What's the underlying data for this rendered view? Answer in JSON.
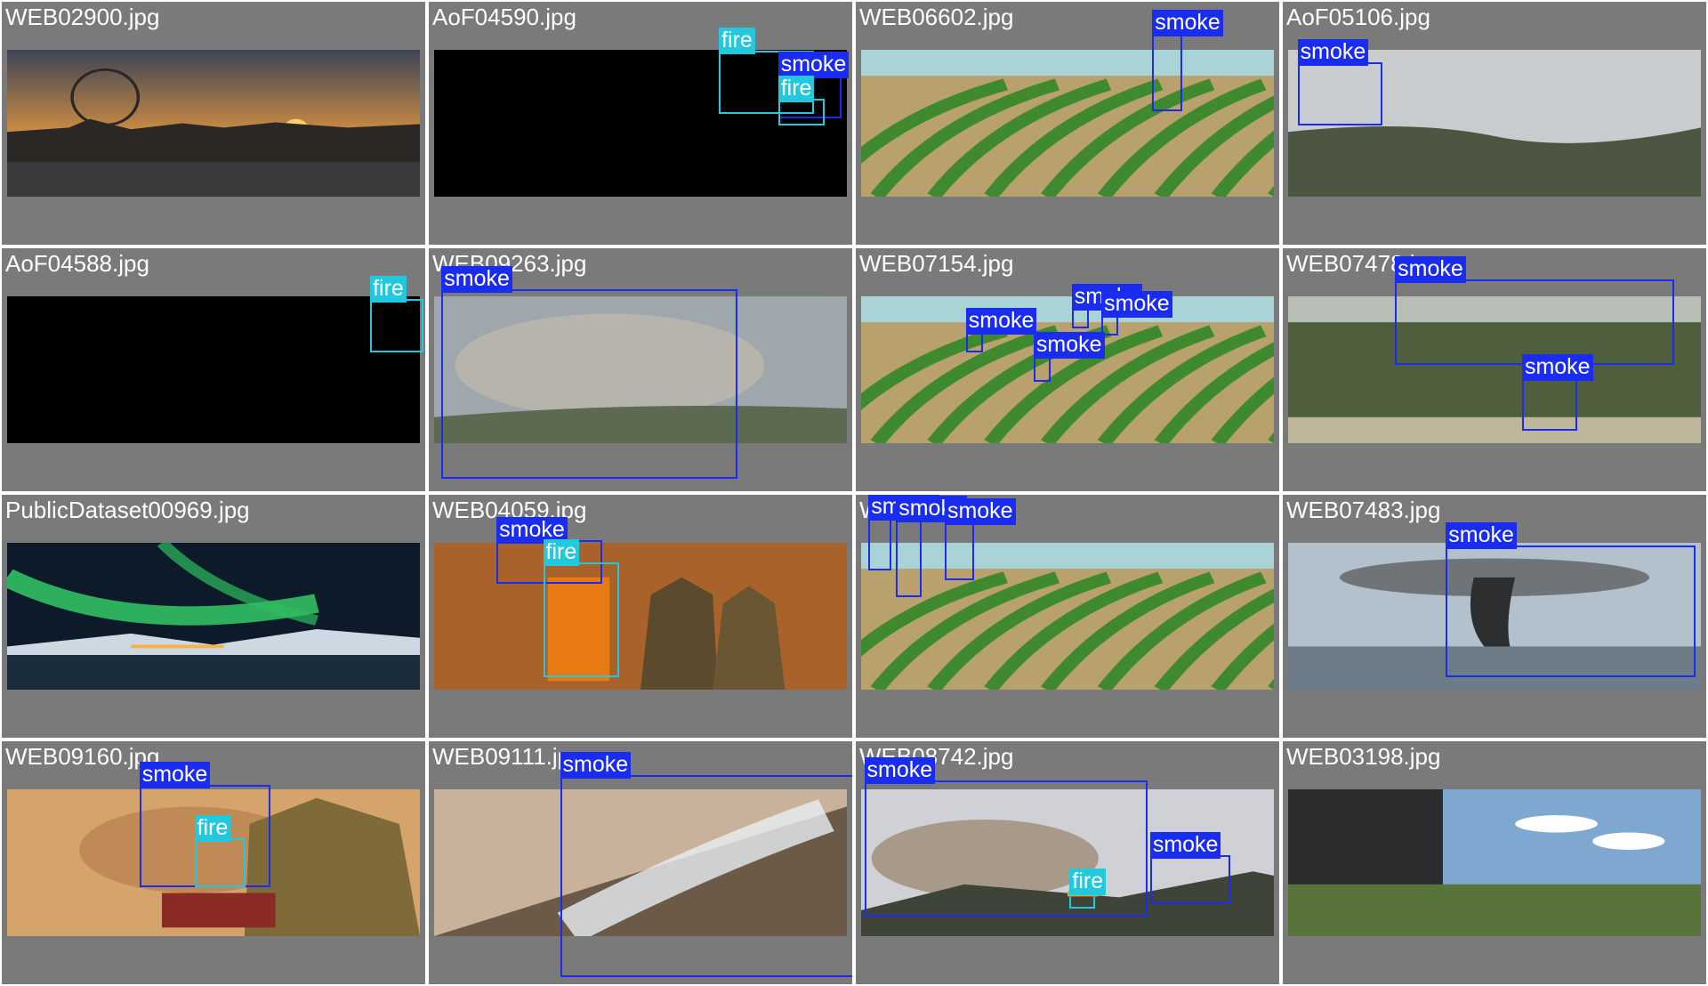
{
  "classes": {
    "smoke": {
      "label": "smoke",
      "color": "#1a2cf0"
    },
    "fire": {
      "label": "fire",
      "color": "#24c8dc"
    }
  },
  "tiles": [
    {
      "file": "WEB02900.jpg",
      "scene": "sunset-city",
      "detections": []
    },
    {
      "file": "AoF04590.jpg",
      "scene": "night-dark",
      "detections": [
        {
          "cls": "fire"
        },
        {
          "cls": "smoke"
        },
        {
          "cls": "fire"
        }
      ]
    },
    {
      "file": "WEB06602.jpg",
      "scene": "crop-field",
      "detections": [
        {
          "cls": "smoke"
        }
      ]
    },
    {
      "file": "AoF05106.jpg",
      "scene": "hazy-hill",
      "detections": [
        {
          "cls": "smoke"
        }
      ]
    },
    {
      "file": "AoF04588.jpg",
      "scene": "night-dark",
      "detections": [
        {
          "cls": "fire"
        }
      ]
    },
    {
      "file": "WEB09263.jpg",
      "scene": "aerial-smoke",
      "detections": [
        {
          "cls": "smoke"
        }
      ]
    },
    {
      "file": "WEB07154.jpg",
      "scene": "crop-field",
      "detections": [
        {
          "cls": "smoke"
        },
        {
          "cls": "smoke"
        },
        {
          "cls": "smoke"
        },
        {
          "cls": "smoke"
        }
      ]
    },
    {
      "file": "WEB07478.jpg",
      "scene": "forest",
      "detections": [
        {
          "cls": "smoke"
        },
        {
          "cls": "smoke"
        }
      ]
    },
    {
      "file": "PublicDataset00969.jpg",
      "scene": "aurora",
      "detections": []
    },
    {
      "file": "WEB04059.jpg",
      "scene": "firefighters",
      "detections": [
        {
          "cls": "smoke"
        },
        {
          "cls": "fire"
        }
      ]
    },
    {
      "file": "WEB06612.jpg",
      "scene": "crop-field",
      "detections": [
        {
          "cls": "smoke"
        },
        {
          "cls": "smoke"
        },
        {
          "cls": "smoke"
        }
      ]
    },
    {
      "file": "WEB07483.jpg",
      "scene": "plume",
      "detections": [
        {
          "cls": "smoke"
        }
      ]
    },
    {
      "file": "WEB09160.jpg",
      "scene": "firefighter-close",
      "detections": [
        {
          "cls": "smoke"
        },
        {
          "cls": "fire"
        }
      ]
    },
    {
      "file": "WEB09111.jpg",
      "scene": "slope-smoke",
      "detections": [
        {
          "cls": "smoke"
        }
      ]
    },
    {
      "file": "WEB08742.jpg",
      "scene": "mountain-fire",
      "detections": [
        {
          "cls": "smoke"
        },
        {
          "cls": "smoke"
        },
        {
          "cls": "fire"
        }
      ]
    },
    {
      "file": "WEB03198.jpg",
      "scene": "stadium-park",
      "detections": []
    }
  ]
}
